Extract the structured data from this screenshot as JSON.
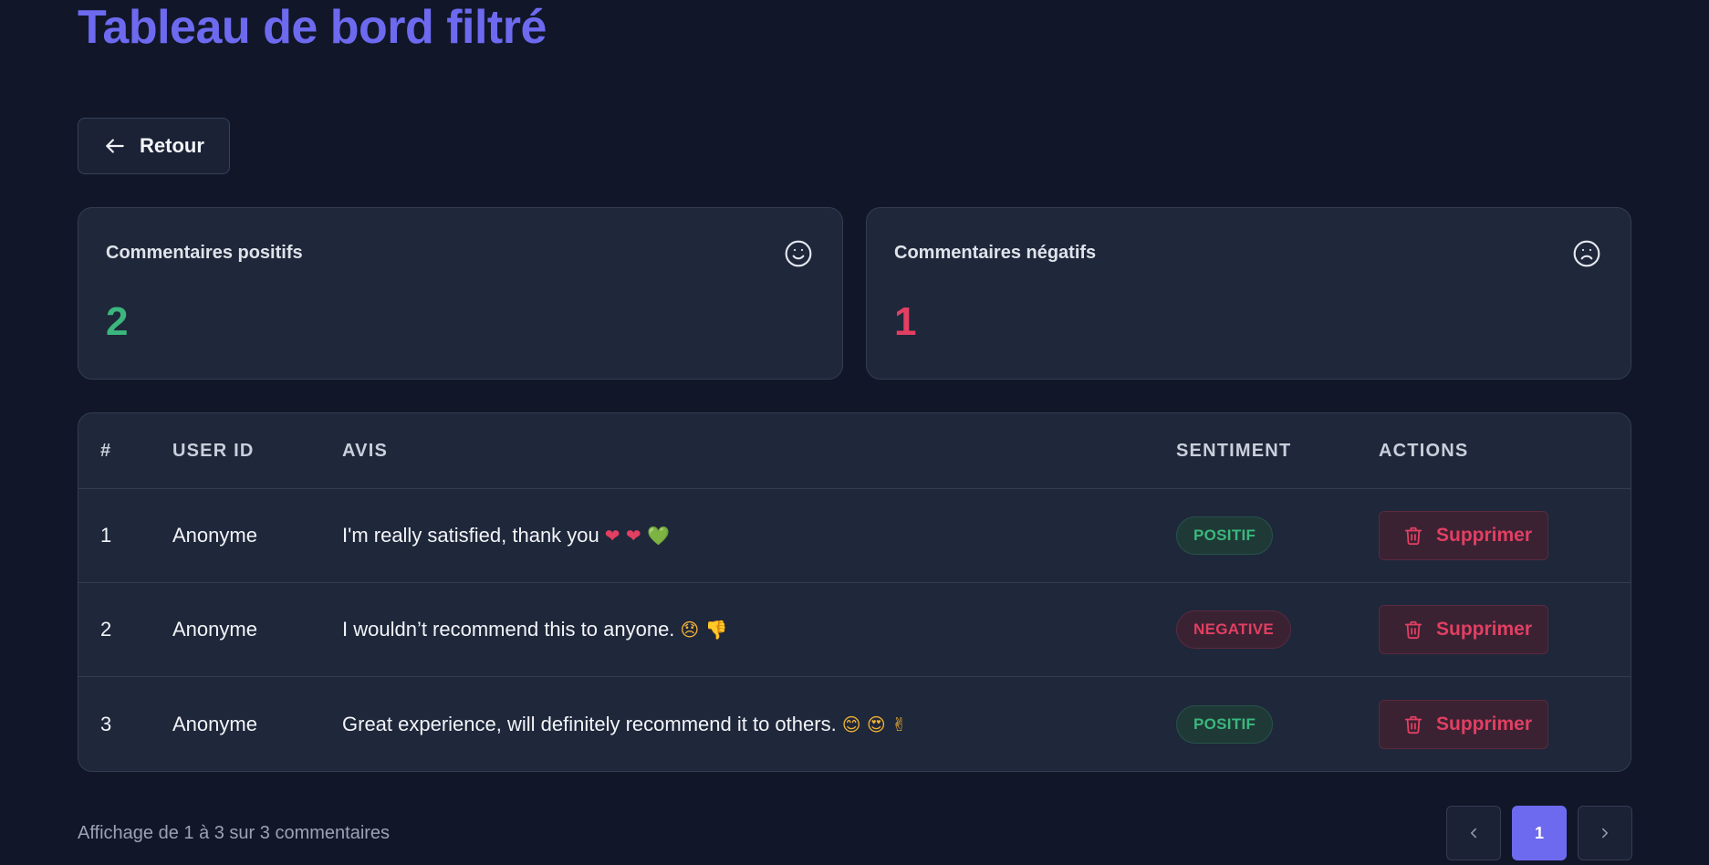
{
  "page": {
    "title": "Tableau de bord filtré"
  },
  "back_button": {
    "label": "Retour"
  },
  "stats": {
    "positive": {
      "label": "Commentaires positifs",
      "value": "2",
      "icon": "smile-icon",
      "color": "#3bb77e"
    },
    "negative": {
      "label": "Commentaires négatifs",
      "value": "1",
      "icon": "frown-icon",
      "color": "#e23f62"
    }
  },
  "table": {
    "headers": [
      "#",
      "USER ID",
      "AVIS",
      "SENTIMENT",
      "ACTIONS"
    ],
    "rows": [
      {
        "index": "1",
        "user": "Anonyme",
        "review": "I'm really satisfied, thank you",
        "emojis": "❤ ❤ 💚",
        "sentiment": "POSITIF",
        "action": "Supprimer"
      },
      {
        "index": "2",
        "user": "Anonyme",
        "review": "I wouldn’t recommend this to anyone.",
        "emojis": "😞 👎",
        "sentiment": "NEGATIVE",
        "action": "Supprimer"
      },
      {
        "index": "3",
        "user": "Anonyme",
        "review": "Great experience, will definitely recommend it to others.",
        "emojis": "😊 😍 ✌",
        "sentiment": "POSITIF",
        "action": "Supprimer"
      }
    ]
  },
  "pagination": {
    "info": "Affichage de 1 à 3 sur 3 commentaires",
    "current_page": "1"
  },
  "colors": {
    "accent": "#6d6af0",
    "positive": "#3bb77e",
    "negative": "#e23f62",
    "background": "#111729"
  }
}
